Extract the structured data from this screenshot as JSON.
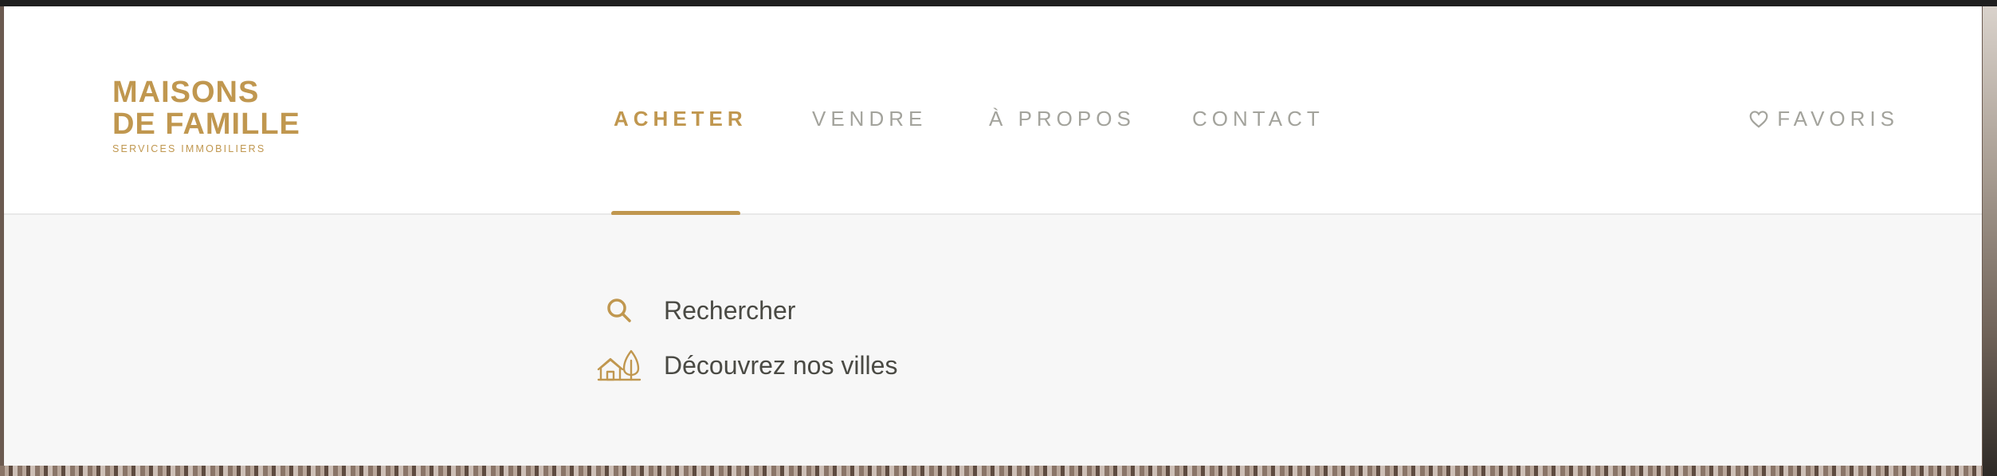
{
  "logo": {
    "line1": "MAISONS",
    "line2": "DE FAMILLE",
    "tagline": "SERVICES IMMOBILIERS"
  },
  "nav": {
    "items": [
      {
        "label": "ACHETER",
        "active": true
      },
      {
        "label": "VENDRE",
        "active": false
      },
      {
        "label": "À PROPOS",
        "active": false
      },
      {
        "label": "CONTACT",
        "active": false
      }
    ],
    "favorites_label": "FAVORIS"
  },
  "dropdown": {
    "items": [
      {
        "label": "Rechercher",
        "icon": "search-icon"
      },
      {
        "label": "Découvrez nos villes",
        "icon": "city-icon"
      }
    ]
  },
  "colors": {
    "accent": "#c0974f",
    "nav_inactive": "#a3a39c",
    "dropdown_bg": "#f7f7f7",
    "text_dark": "#4a4a44"
  }
}
